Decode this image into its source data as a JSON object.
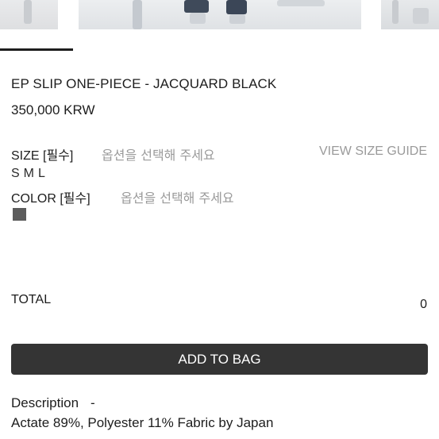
{
  "product": {
    "title": "EP SLIP ONE-PIECE - JACQUARD BLACK",
    "price": "350,000 KRW"
  },
  "size_option": {
    "label": "SIZE [필수]",
    "placeholder": "옵션을 선택해 주세요",
    "guide_link": "VIEW SIZE GUIDE",
    "values": [
      "S",
      "M",
      "L"
    ]
  },
  "color_option": {
    "label": "COLOR [필수]",
    "placeholder": "옵션을 선택해 주세요",
    "swatch_color": "#5c5c5c"
  },
  "total": {
    "label": "TOTAL",
    "value": "0"
  },
  "actions": {
    "add_to_bag": "ADD TO BAG"
  },
  "description": {
    "label": "Description",
    "toggle": "-",
    "text": "Actate 89%, Polyester 11% Fabric by Japan"
  },
  "colors": {
    "button_bg": "#343434",
    "placeholder": "#9a9a9a"
  }
}
